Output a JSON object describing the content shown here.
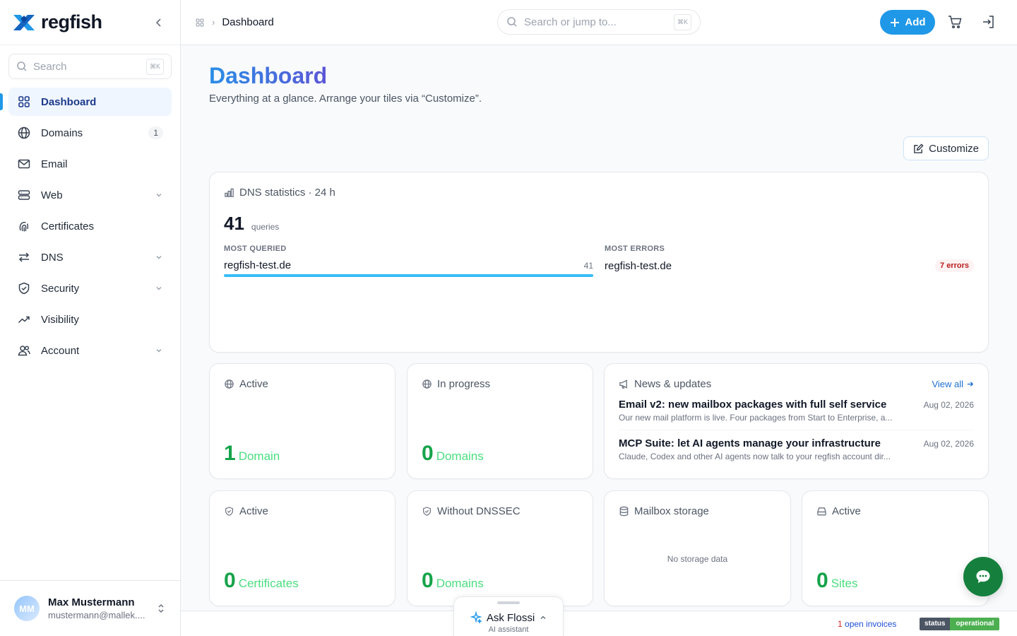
{
  "app": {
    "name": "regfish"
  },
  "sidebar": {
    "search_placeholder": "Search",
    "search_kbd": "⌘K",
    "items": [
      {
        "label": "Dashboard",
        "icon": "dashboard-grid-icon",
        "active": true
      },
      {
        "label": "Domains",
        "icon": "globe-icon",
        "badge": "1"
      },
      {
        "label": "Email",
        "icon": "mail-icon"
      },
      {
        "label": "Web",
        "icon": "server-icon",
        "has_children": true
      },
      {
        "label": "Certificates",
        "icon": "fingerprint-icon"
      },
      {
        "label": "DNS",
        "icon": "arrows-exchange-icon",
        "has_children": true
      },
      {
        "label": "Security",
        "icon": "shield-check-icon",
        "has_children": true
      },
      {
        "label": "Visibility",
        "icon": "trending-up-icon"
      },
      {
        "label": "Account",
        "icon": "users-icon",
        "has_children": true
      }
    ]
  },
  "user": {
    "initials": "MM",
    "name": "Max Mustermann",
    "email": "mustermann@mallek...."
  },
  "topbar": {
    "breadcrumb_current": "Dashboard",
    "breadcrumb_separator": "›",
    "search_placeholder": "Search or jump to...",
    "search_kbd": "⌘K",
    "add_label": "Add"
  },
  "page": {
    "title": "Dashboard",
    "subtitle": "Everything at a glance. Arrange your tiles via “Customize”.",
    "customize_label": "Customize"
  },
  "dns_stats": {
    "title": "DNS statistics · 24 h",
    "queries": "41",
    "queries_unit": "queries",
    "most_queried_label": "MOST QUERIED",
    "most_queried": {
      "domain": "regfish-test.de",
      "count": "41",
      "share": 1.0
    },
    "most_errors_label": "MOST ERRORS",
    "most_errors": {
      "domain": "regfish-test.de",
      "badge": "7 errors"
    }
  },
  "tiles": {
    "domains_active": {
      "title": "Active",
      "value": "1",
      "unit": "Domain"
    },
    "domains_in_progress": {
      "title": "In progress",
      "value": "0",
      "unit": "Domains"
    },
    "certs_active": {
      "title": "Active",
      "value": "0",
      "unit": "Certificates"
    },
    "without_dnssec": {
      "title": "Without DNSSEC",
      "value": "0",
      "unit": "Domains"
    },
    "mailbox_storage": {
      "title": "Mailbox storage",
      "empty": "No storage data"
    },
    "sites_active": {
      "title": "Active",
      "value": "0",
      "unit": "Sites"
    }
  },
  "news": {
    "title": "News & updates",
    "view_all": "View all",
    "items": [
      {
        "title": "Email v2: new mailbox packages with full self service",
        "desc": "Our new mail platform is live. Four packages from Start to Enterprise, a...",
        "date": "Aug 02, 2026"
      },
      {
        "title": "MCP Suite: let AI agents manage your infrastructure",
        "desc": "Claude, Codex and other AI agents now talk to your regfish account dir...",
        "date": "Aug 02, 2026"
      }
    ]
  },
  "footer": {
    "invoices_count": "1",
    "invoices_label": " open invoices",
    "status_label": "status",
    "status_value": "operational"
  },
  "assistant": {
    "title": "Ask Flossi",
    "subtitle": "AI assistant"
  },
  "colors": {
    "accent": "#1f98e8",
    "success": "#16a34a",
    "error": "#b91c1c",
    "status_ok": "#4caf50"
  }
}
